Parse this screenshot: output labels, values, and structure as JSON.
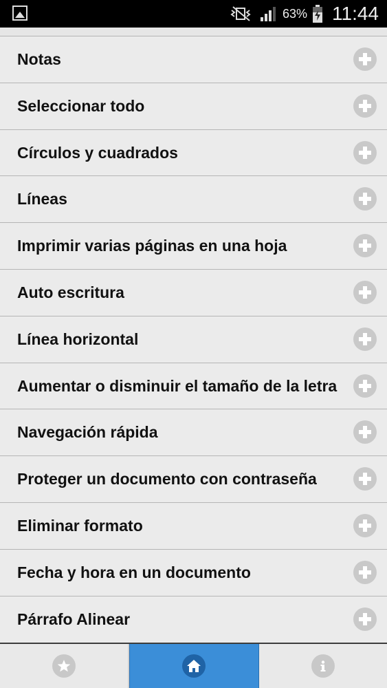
{
  "status_bar": {
    "battery_percent": "63%",
    "time": "11:44",
    "icons": [
      "image-notification-icon",
      "mute-vibrate-icon",
      "signal-icon",
      "battery-charging-icon"
    ]
  },
  "list": {
    "items": [
      {
        "label": "Notas"
      },
      {
        "label": "Seleccionar todo"
      },
      {
        "label": "Círculos y cuadrados"
      },
      {
        "label": "Líneas"
      },
      {
        "label": "Imprimir varias páginas en una hoja"
      },
      {
        "label": "Auto escritura"
      },
      {
        "label": "Línea horizontal"
      },
      {
        "label": "Aumentar o disminuir el tamaño de la letra"
      },
      {
        "label": "Navegación rápida"
      },
      {
        "label": "Proteger un documento con contraseña"
      },
      {
        "label": "Eliminar formato"
      },
      {
        "label": "Fecha y hora en un documento"
      },
      {
        "label": "Párrafo Alinear"
      }
    ],
    "expand_icon": "plus-circle-icon"
  },
  "tab_bar": {
    "tabs": [
      {
        "icon": "star-icon",
        "active": false
      },
      {
        "icon": "home-icon",
        "active": true
      },
      {
        "icon": "info-icon",
        "active": false
      }
    ],
    "active_color": "#3b8ed8"
  }
}
